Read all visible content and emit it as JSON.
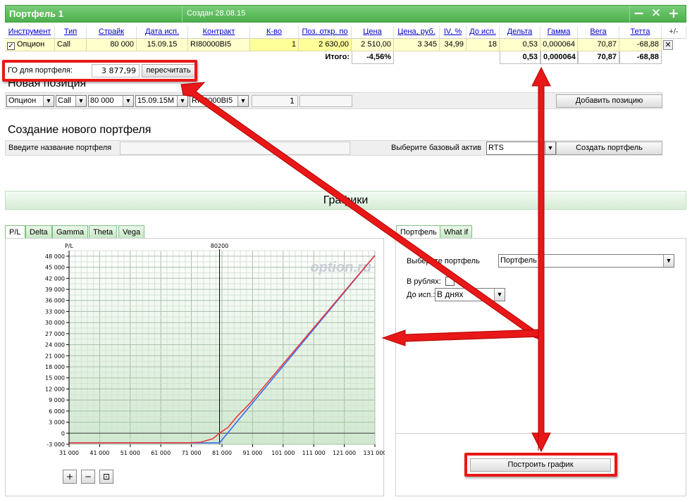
{
  "portfolio": {
    "title": "Портфель 1",
    "created": "Создан 28.08.15",
    "btn_minimize": "−",
    "btn_close": "✕",
    "btn_add": "+"
  },
  "table": {
    "headers": [
      "Инструмент",
      "Тип",
      "Страйк",
      "Дата исп.",
      "Контракт",
      "К-во",
      "Поз. откр. по",
      "Цена",
      "Цена, руб.",
      "IV, %",
      "До исп.",
      "Дельта",
      "Гамма",
      "Вега",
      "Тетта",
      "+/-"
    ],
    "row": {
      "instrument": "Опцион",
      "type": "Call",
      "strike": "80 000",
      "exp_date": "15.09.15",
      "contract": "RI80000BI5",
      "qty": "1",
      "open_price": "2 630,00",
      "price": "2 510,00",
      "price_rub": "3 345",
      "iv": "34,99",
      "days": "18",
      "delta": "0,53",
      "gamma": "0,000064",
      "vega": "70,87",
      "theta": "-68,88",
      "remove": "✕"
    },
    "totals": {
      "label": "Итого:",
      "price": "-4,56%",
      "delta": "0,53",
      "gamma": "0,000064",
      "vega": "70,87",
      "theta": "-68,88"
    }
  },
  "go": {
    "label": "ГО для портфеля:",
    "value": "3 877,99",
    "recalc": "пересчитать"
  },
  "new_position": {
    "title": "Новая позиция",
    "instrument": "Опцион",
    "type": "Call",
    "strike": "80 000",
    "date": "15.09.15M",
    "contract": "RI80000BI5",
    "qty": "1",
    "add_button": "Добавить позицию"
  },
  "new_portfolio": {
    "title": "Создание нового портфеля",
    "name_label": "Введите название портфеля",
    "asset_label": "Выберите базовый актив",
    "asset_value": "RTS",
    "create_button": "Создать портфель"
  },
  "charts": {
    "title": "Графики",
    "tabs": [
      "P/L",
      "Delta",
      "Gamma",
      "Theta",
      "Vega"
    ],
    "right_tabs": [
      "Портфель",
      "What if"
    ],
    "select_portfolio_label": "Выберите портфель",
    "select_portfolio_value": "Портфель",
    "in_rubles_label": "В рублях:",
    "to_exp_label": "До исп.:",
    "to_exp_value": "В днях",
    "build_button": "Построить график",
    "watermark": "option.ru",
    "zoom_in": "+",
    "zoom_out": "−",
    "zoom_fit": "⊡"
  },
  "chart_data": {
    "type": "line",
    "ylabel": "P/L",
    "marker_label": "80200",
    "marker_x": 80200,
    "xlim": [
      31000,
      131000
    ],
    "ylim": [
      -3000,
      48000
    ],
    "x_ticks": [
      "31 000",
      "41 000",
      "51 000",
      "61 000",
      "71 000",
      "81 000",
      "91 000",
      "101 000",
      "111 000",
      "121 000",
      "131 000"
    ],
    "y_ticks": [
      "-3 000",
      "0",
      "3 000",
      "6 000",
      "9 000",
      "12 000",
      "15 000",
      "18 000",
      "21 000",
      "24 000",
      "27 000",
      "30 000",
      "33 000",
      "36 000",
      "39 000",
      "42 000",
      "45 000",
      "48 000"
    ],
    "grid": true,
    "series": [
      {
        "color": "#3a6cf0",
        "x": [
          31000,
          80200,
          82800,
          131000
        ],
        "y": [
          -2630,
          -2630,
          0,
          48200
        ]
      },
      {
        "color": "#e83a3a",
        "x": [
          31000,
          70000,
          74000,
          78000,
          80200,
          83000,
          86000,
          90000,
          131000
        ],
        "y": [
          -2630,
          -2600,
          -2450,
          -1500,
          0,
          1600,
          4600,
          8000,
          48200
        ]
      }
    ]
  }
}
